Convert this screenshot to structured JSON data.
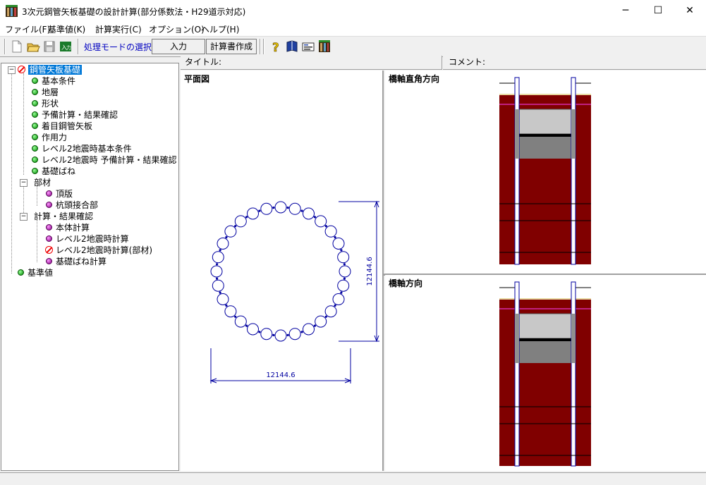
{
  "window": {
    "title": "3次元鋼管矢板基礎の設計計算(部分係数法・H29道示対応)",
    "controls": {
      "minimize": "─",
      "maximize": "☐",
      "close": "✕"
    }
  },
  "menu": [
    "ファイル(F)",
    "基準値(K)",
    "計算実行(C)",
    "オプション(O)",
    "ヘルプ(H)"
  ],
  "toolbar": {
    "mode_label": "処理モードの選択",
    "mode_value": "入力",
    "report_button": "計算書作成"
  },
  "header": {
    "title_label": "タイトル:",
    "comment_label": "コメント:"
  },
  "tree": {
    "root": "鋼管矢板基礎",
    "items": [
      {
        "label": "基本条件",
        "status": "green"
      },
      {
        "label": "地層",
        "status": "green"
      },
      {
        "label": "形状",
        "status": "green"
      },
      {
        "label": "予備計算・結果確認",
        "status": "green"
      },
      {
        "label": "着目鋼管矢板",
        "status": "green"
      },
      {
        "label": "作用力",
        "status": "green"
      },
      {
        "label": "レベル2地震時基本条件",
        "status": "green"
      },
      {
        "label": "レベル2地震時 予備計算・結果確認",
        "status": "green"
      },
      {
        "label": "基礎ばね",
        "status": "green"
      }
    ],
    "group1": {
      "label": "部材",
      "children": [
        {
          "label": "頂版",
          "status": "purple"
        },
        {
          "label": "杭頭接合部",
          "status": "purple"
        }
      ]
    },
    "group2": {
      "label": "計算・結果確認",
      "children": [
        {
          "label": "本体計算",
          "status": "purple"
        },
        {
          "label": "レベル2地震時計算",
          "status": "purple"
        },
        {
          "label": "レベル2地震時計算(部材)",
          "status": "error"
        },
        {
          "label": "基礎ばね計算",
          "status": "purple"
        }
      ]
    },
    "standard": {
      "label": "基準値",
      "status": "green"
    }
  },
  "plan_view": {
    "title": "平面図",
    "dim_horizontal": "12144.6",
    "dim_vertical": "12144.6"
  },
  "section_views": {
    "perpendicular_title": "橋軸直角方向",
    "parallel_title": "橋軸方向"
  },
  "colors": {
    "accent": "#0078d7",
    "soil": "#800000",
    "pile_outline": "#0000a0",
    "cap_gray": "#c0c0c0"
  }
}
